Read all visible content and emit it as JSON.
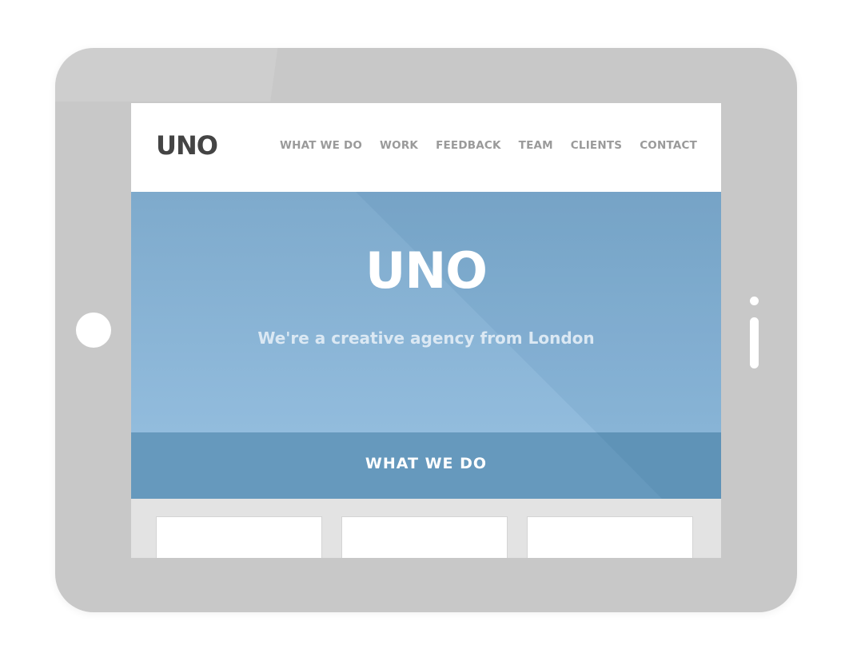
{
  "header": {
    "logo": "UNO",
    "nav": [
      {
        "label": "WHAT WE DO"
      },
      {
        "label": "WORK"
      },
      {
        "label": "FEEDBACK"
      },
      {
        "label": "TEAM"
      },
      {
        "label": "CLIENTS"
      },
      {
        "label": "CONTACT"
      }
    ]
  },
  "hero": {
    "title": "UNO",
    "subtitle": "We're a creative agency from London"
  },
  "section": {
    "title": "WHAT WE DO"
  },
  "colors": {
    "hero_blue": "#7eaacc",
    "section_blue": "#6699bd",
    "device_gray": "#c8c8c8",
    "logo_dark": "#444444",
    "nav_gray": "#9a9a9a"
  }
}
